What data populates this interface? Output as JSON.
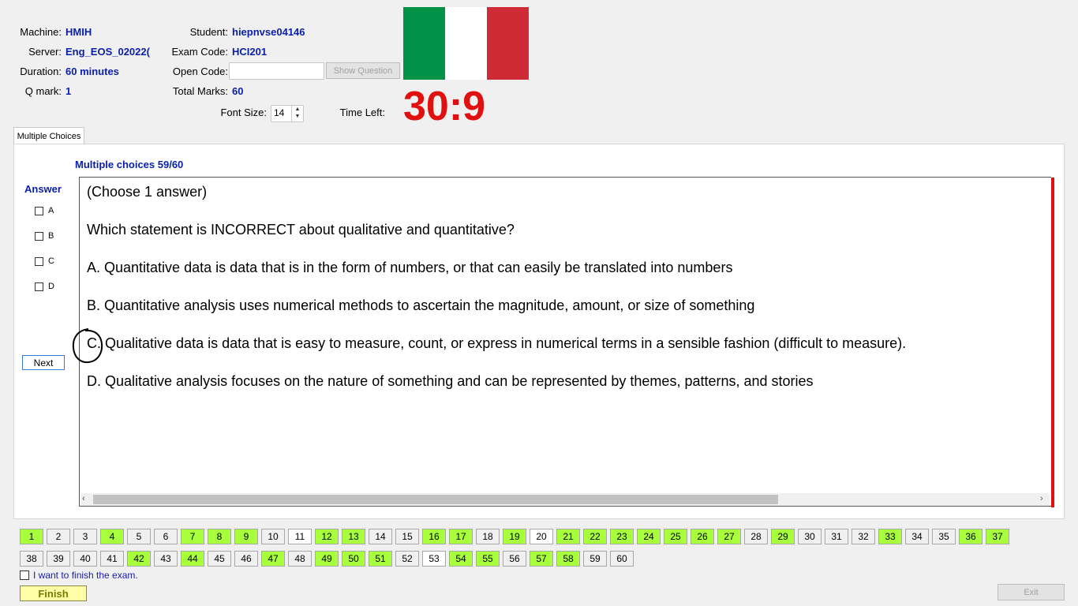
{
  "header": {
    "machine_label": "Machine:",
    "machine_value": "HMIH",
    "server_label": "Server:",
    "server_value": "Eng_EOS_02022(",
    "duration_label": "Duration:",
    "duration_value": "60 minutes",
    "qmark_label": "Q mark:",
    "qmark_value": "1",
    "student_label": "Student:",
    "student_value": "hiepnvse04146",
    "exam_code_label": "Exam Code:",
    "exam_code_value": "HCI201",
    "open_code_label": "Open Code:",
    "open_code_value": "",
    "show_question_label": "Show Question",
    "total_marks_label": "Total Marks:",
    "total_marks_value": "60",
    "font_size_label": "Font Size:",
    "font_size_value": "14",
    "time_left_label": "Time Left:",
    "time_left_value": "30:9",
    "flag_colors": [
      "#009246",
      "#ffffff",
      "#ce2b37"
    ]
  },
  "tabs": [
    {
      "label": "Multiple Choices"
    }
  ],
  "main": {
    "counter": "Multiple choices 59/60",
    "answer_heading": "Answer",
    "answer_options": [
      "A",
      "B",
      "C",
      "D"
    ],
    "next_label": "Next",
    "question_lines": [
      "(Choose 1 answer)",
      "Which statement is INCORRECT about qualitative and quantitative?",
      "A.  Quantitative data is data that is in the form of numbers, or that can easily be translated into numbers",
      "B.  Quantitative analysis uses numerical methods to ascertain the magnitude, amount, or size of something",
      "C.  Qualitative data is data that is easy to measure, count, or express in numerical terms in a sensible fashion (difficult to measure).",
      "D.  Qualitative analysis focuses on the nature of something and can be represented by themes, patterns, and stories"
    ]
  },
  "navigation": {
    "row1": [
      {
        "n": "1",
        "state": "answered"
      },
      {
        "n": "2",
        "state": "none"
      },
      {
        "n": "3",
        "state": "none"
      },
      {
        "n": "4",
        "state": "answered"
      },
      {
        "n": "5",
        "state": "none"
      },
      {
        "n": "6",
        "state": "none"
      },
      {
        "n": "7",
        "state": "answered"
      },
      {
        "n": "8",
        "state": "answered"
      },
      {
        "n": "9",
        "state": "answered"
      },
      {
        "n": "10",
        "state": "none"
      },
      {
        "n": "11",
        "state": "current"
      },
      {
        "n": "12",
        "state": "answered"
      },
      {
        "n": "13",
        "state": "answered"
      },
      {
        "n": "14",
        "state": "none"
      },
      {
        "n": "15",
        "state": "none"
      },
      {
        "n": "16",
        "state": "answered"
      },
      {
        "n": "17",
        "state": "answered"
      },
      {
        "n": "18",
        "state": "none"
      },
      {
        "n": "19",
        "state": "answered"
      },
      {
        "n": "20",
        "state": "current"
      },
      {
        "n": "21",
        "state": "answered"
      },
      {
        "n": "22",
        "state": "answered"
      },
      {
        "n": "23",
        "state": "answered"
      },
      {
        "n": "24",
        "state": "answered"
      },
      {
        "n": "25",
        "state": "answered"
      },
      {
        "n": "26",
        "state": "answered"
      },
      {
        "n": "27",
        "state": "answered"
      },
      {
        "n": "28",
        "state": "none"
      },
      {
        "n": "29",
        "state": "answered"
      },
      {
        "n": "30",
        "state": "none"
      },
      {
        "n": "31",
        "state": "none"
      },
      {
        "n": "32",
        "state": "none"
      },
      {
        "n": "33",
        "state": "answered"
      },
      {
        "n": "34",
        "state": "none"
      },
      {
        "n": "35",
        "state": "none"
      },
      {
        "n": "36",
        "state": "answered"
      },
      {
        "n": "37",
        "state": "answered"
      }
    ],
    "row2": [
      {
        "n": "38",
        "state": "none"
      },
      {
        "n": "39",
        "state": "none"
      },
      {
        "n": "40",
        "state": "none"
      },
      {
        "n": "41",
        "state": "none"
      },
      {
        "n": "42",
        "state": "answered"
      },
      {
        "n": "43",
        "state": "none"
      },
      {
        "n": "44",
        "state": "answered"
      },
      {
        "n": "45",
        "state": "none"
      },
      {
        "n": "46",
        "state": "none"
      },
      {
        "n": "47",
        "state": "answered"
      },
      {
        "n": "48",
        "state": "none"
      },
      {
        "n": "49",
        "state": "answered"
      },
      {
        "n": "50",
        "state": "answered"
      },
      {
        "n": "51",
        "state": "answered"
      },
      {
        "n": "52",
        "state": "none"
      },
      {
        "n": "53",
        "state": "current"
      },
      {
        "n": "54",
        "state": "answered"
      },
      {
        "n": "55",
        "state": "answered"
      },
      {
        "n": "56",
        "state": "none"
      },
      {
        "n": "57",
        "state": "answered"
      },
      {
        "n": "58",
        "state": "answered"
      },
      {
        "n": "59",
        "state": "none"
      },
      {
        "n": "60",
        "state": "none"
      }
    ]
  },
  "footer": {
    "finish_confirm_label": "I want to finish the exam.",
    "finish_label": "Finish",
    "exit_label": "Exit"
  }
}
